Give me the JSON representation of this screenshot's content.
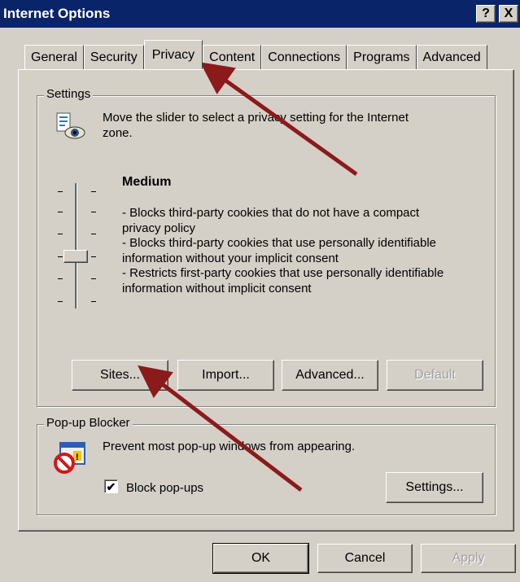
{
  "window": {
    "title": "Internet Options",
    "help_glyph": "?",
    "close_glyph": "X"
  },
  "tabs": [
    {
      "label": "General"
    },
    {
      "label": "Security"
    },
    {
      "label": "Privacy",
      "active": true
    },
    {
      "label": "Content"
    },
    {
      "label": "Connections"
    },
    {
      "label": "Programs"
    },
    {
      "label": "Advanced"
    }
  ],
  "settings": {
    "group_label": "Settings",
    "description_line1": "Move the slider to select a privacy setting for the Internet",
    "description_line2": "zone.",
    "level_title": "Medium",
    "level_lines": [
      "- Blocks third-party cookies that do not have a compact",
      "privacy policy",
      "- Blocks third-party cookies that use personally identifiable",
      "information without your implicit consent",
      "- Restricts first-party cookies that use personally identifiable",
      "information without implicit consent"
    ],
    "slider_level": "Medium",
    "buttons": {
      "sites": "Sites...",
      "import": "Import...",
      "advanced": "Advanced...",
      "default": "Default"
    }
  },
  "popup": {
    "group_label": "Pop-up Blocker",
    "description": "Prevent most pop-up windows from appearing.",
    "checkbox_label": "Block pop-ups",
    "checkbox_checked": true,
    "check_glyph": "✔",
    "settings_button": "Settings..."
  },
  "footer": {
    "ok": "OK",
    "cancel": "Cancel",
    "apply": "Apply"
  },
  "colors": {
    "titlebar": "#0a246a",
    "face": "#d4d0c8",
    "arrow": "#8b1a1a"
  }
}
